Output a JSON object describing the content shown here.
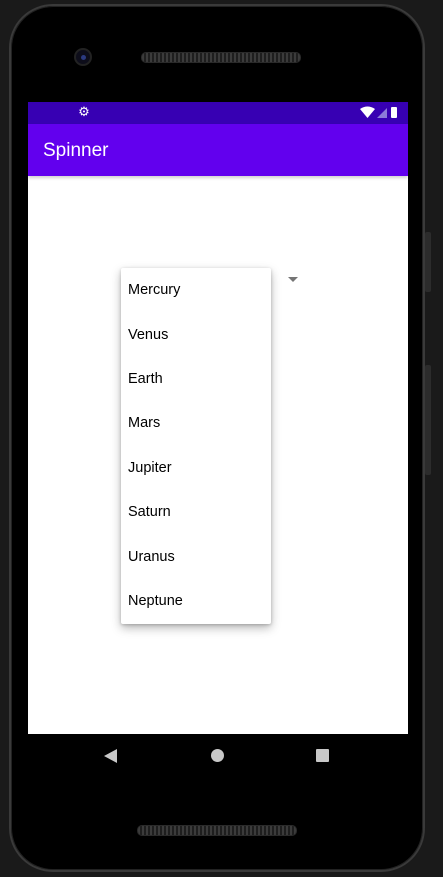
{
  "app_bar": {
    "title": "Spinner"
  },
  "status_bar": {
    "icons": [
      "settings-gear-icon",
      "wifi-icon",
      "cell-signal-icon",
      "battery-icon"
    ],
    "color": "#3700b3"
  },
  "colors": {
    "primary": "#6200ee",
    "primary_dark": "#3700b3"
  },
  "spinner": {
    "options": [
      "Mercury",
      "Venus",
      "Earth",
      "Mars",
      "Jupiter",
      "Saturn",
      "Uranus",
      "Neptune"
    ]
  },
  "navigation_bar": {
    "buttons": [
      "back-icon",
      "home-icon",
      "recents-icon"
    ]
  }
}
